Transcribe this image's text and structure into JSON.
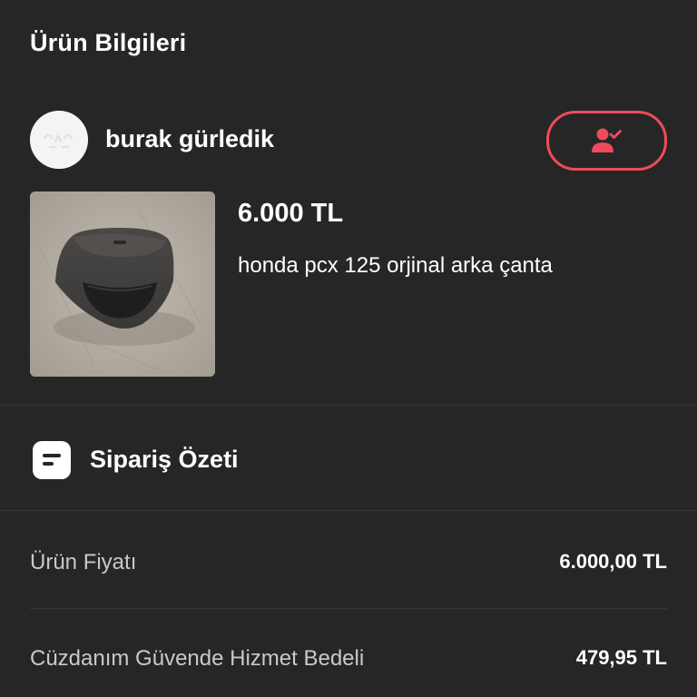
{
  "product_info": {
    "title": "Ürün Bilgileri",
    "seller": {
      "name": "burak gürledik",
      "avatar_text": "•,•.",
      "follow_icon": "user-check-icon"
    },
    "product": {
      "price": "6.000 TL",
      "title": "honda pcx 125 orjinal arka çanta",
      "image": "motorcycle-top-case-photo"
    }
  },
  "order_summary": {
    "title": "Sipariş Özeti",
    "icon": "receipt-icon",
    "lines": [
      {
        "label": "Ürün Fiyatı",
        "value": "6.000,00 TL"
      },
      {
        "label": "Cüzdanım Güvende Hizmet Bedeli",
        "value": "479,95 TL"
      }
    ]
  },
  "colors": {
    "background": "#262626",
    "accent": "#ef4b5c",
    "text_primary": "#ffffff",
    "text_secondary": "#c9c9c9",
    "divider": "#363636"
  }
}
